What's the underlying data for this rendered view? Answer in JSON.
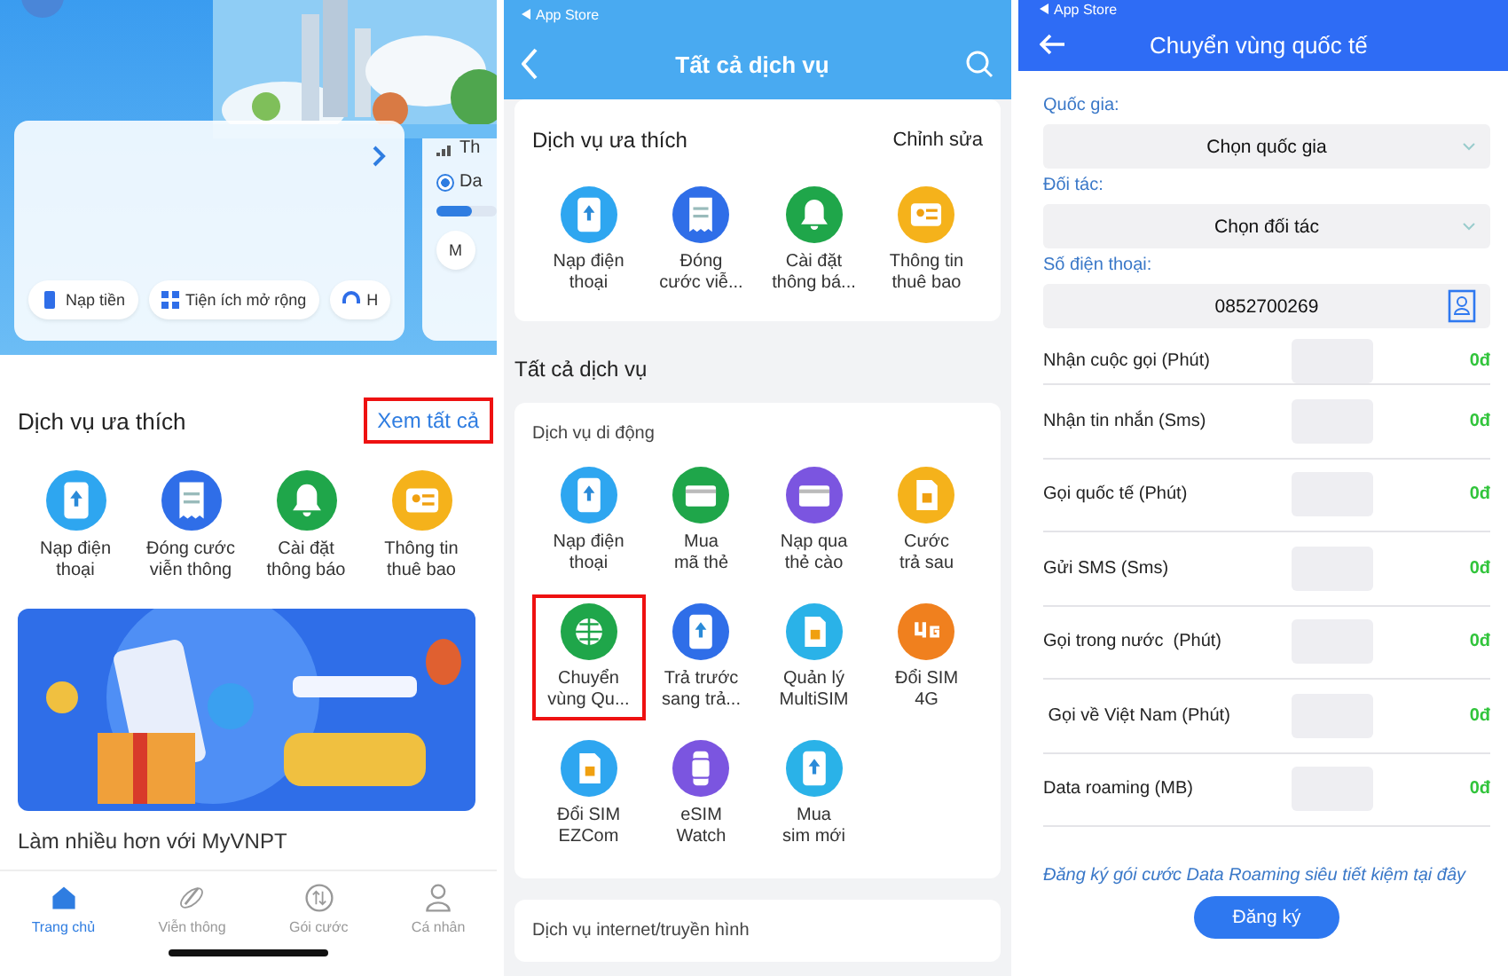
{
  "home": {
    "quick_actions": [
      {
        "label": "Nạp tiền",
        "kind": "wallet"
      },
      {
        "label": "Tiện ích mở rộng",
        "kind": "grid"
      },
      {
        "label": "H",
        "kind": "headset"
      }
    ],
    "side_card": {
      "title": "Th",
      "option": "Da",
      "option_selected": true,
      "level": 0.6,
      "button": "M"
    },
    "favorites": {
      "title": "Dịch vụ ưa thích",
      "action": "Xem tất cả",
      "action_highlighted": true,
      "items": [
        {
          "label": "Nạp điện\nthoại",
          "kind": "phone",
          "color": "#2ea6f0"
        },
        {
          "label": "Đóng cước\nviễn thông",
          "kind": "bill",
          "color": "#2f6ee8"
        },
        {
          "label": "Cài đặt\nthông báo",
          "kind": "bell",
          "color": "#1fa64a"
        },
        {
          "label": "Thông tin\nthuê bao",
          "kind": "idcard",
          "color": "#f5b21b"
        }
      ]
    },
    "more_title": "Làm nhiều hơn với MyVNPT",
    "nav": [
      {
        "label": "Trang chủ",
        "kind": "home",
        "selected": true
      },
      {
        "label": "Viễn thông",
        "kind": "orbit",
        "selected": false
      },
      {
        "label": "Gói cước",
        "kind": "swap",
        "selected": false
      },
      {
        "label": "Cá nhân",
        "kind": "user",
        "selected": false
      }
    ]
  },
  "services": {
    "status": "App Store",
    "title": "Tất cả dịch vụ",
    "favorites": {
      "title": "Dịch vụ ưa thích",
      "action": "Chỉnh sửa",
      "items": [
        {
          "label": "Nạp điện\nthoại",
          "kind": "phone",
          "color": "#2ea6f0"
        },
        {
          "label": "Đóng\ncước viễ...",
          "kind": "bill",
          "color": "#2f6ee8"
        },
        {
          "label": "Cài đặt\nthông bá...",
          "kind": "bell",
          "color": "#1fa64a"
        },
        {
          "label": "Thông tin\nthuê bao",
          "kind": "idcard",
          "color": "#f5b21b"
        }
      ]
    },
    "all_title": "Tất cả dịch vụ",
    "mobile": {
      "title": "Dịch vụ di động",
      "items": [
        {
          "label": "Nạp điện\nthoại",
          "kind": "phone",
          "color": "#2ea6f0",
          "highlighted": false
        },
        {
          "label": "Mua\nmã thẻ",
          "kind": "card",
          "color": "#1fa64a",
          "highlighted": false
        },
        {
          "label": "Nạp qua\nthẻ cào",
          "kind": "card",
          "color": "#7b55e0",
          "highlighted": false
        },
        {
          "label": "Cước\ntrả sau",
          "kind": "sim",
          "color": "#f5b21b",
          "highlighted": false
        },
        {
          "label": "Chuyển\nvùng Qu...",
          "kind": "globe",
          "color": "#1fa64a",
          "highlighted": true
        },
        {
          "label": "Trả trước\nsang trả...",
          "kind": "phone",
          "color": "#2f6ee8",
          "highlighted": false
        },
        {
          "label": "Quản lý\nMultiSIM",
          "kind": "sim",
          "color": "#2ab2e8",
          "highlighted": false
        },
        {
          "label": "Đổi SIM\n4G",
          "kind": "fourg",
          "color": "#f0801e",
          "highlighted": false
        },
        {
          "label": "Đổi SIM\nEZCom",
          "kind": "sim",
          "color": "#2ea6f0",
          "highlighted": false
        },
        {
          "label": "eSIM\nWatch",
          "kind": "watch",
          "color": "#7b55e0",
          "highlighted": false
        },
        {
          "label": "Mua\nsim mới",
          "kind": "phone",
          "color": "#2ab2e8",
          "highlighted": false
        }
      ]
    },
    "internet_title": "Dịch vụ internet/truyền hình"
  },
  "roaming": {
    "status": "App Store",
    "title": "Chuyển vùng quốc tế",
    "fields": [
      {
        "label": "Quốc gia:",
        "kind": "select",
        "value": "Chọn quốc gia"
      },
      {
        "label": "Đối tác:",
        "kind": "select",
        "value": "Chọn đối tác"
      },
      {
        "label": "Số điện thoại:",
        "kind": "phone",
        "value": "0852700269"
      }
    ],
    "rows": [
      {
        "label": "Nhận cuộc gọi (Phút)",
        "price": "0đ"
      },
      {
        "label": "Nhận tin nhắn (Sms)",
        "price": "0đ"
      },
      {
        "label": "Gọi quốc tế (Phút)",
        "price": "0đ"
      },
      {
        "label": "Gửi SMS (Sms)",
        "price": "0đ"
      },
      {
        "label": "Gọi trong nước  (Phút)",
        "price": "0đ"
      },
      {
        "label": " Gọi về Việt Nam (Phút)",
        "price": "0đ"
      },
      {
        "label": "Data roaming (MB)",
        "price": "0đ"
      }
    ],
    "promo": "Đăng ký gói cước Data Roaming siêu tiết kiệm tại đây",
    "submit": "Đăng ký"
  }
}
